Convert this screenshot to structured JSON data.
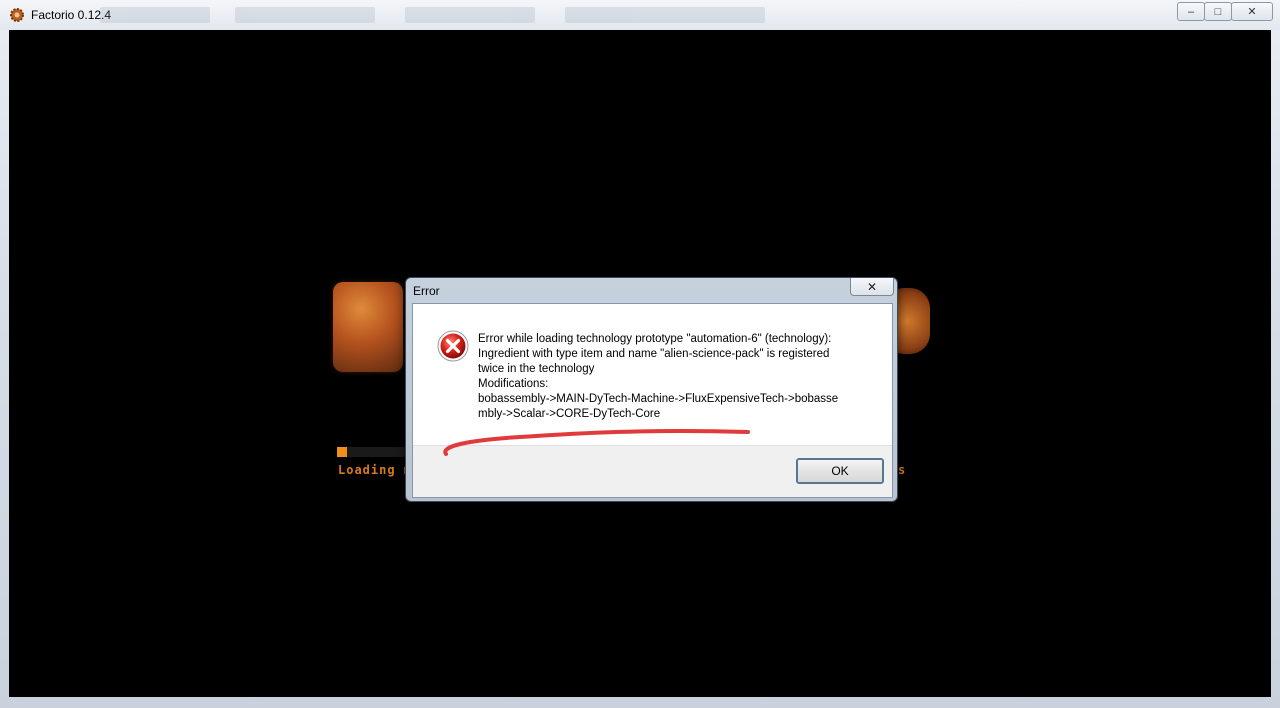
{
  "window": {
    "title": "Factorio 0.12.4",
    "minimize_glyph": "–",
    "maximize_glyph": "□",
    "close_glyph": "✕"
  },
  "loading": {
    "label": "Loading m",
    "right_label": "s",
    "progress_fraction": 0.07,
    "accent_color": "#f28f1a"
  },
  "dialog": {
    "title": "Error",
    "close_glyph": "✕",
    "icon": "error-icon",
    "message_lines": [
      "Error while loading technology prototype \"automation-6\" (technology):",
      "Ingredient with type item and name \"alien-science-pack\" is registered",
      "twice in the technology",
      "Modifications:",
      "bobassembly->MAIN-DyTech-Machine->FluxExpensiveTech->bobasse",
      "mbly->Scalar->CORE-DyTech-Core"
    ],
    "ok_label": "OK",
    "annotation_color": "#e03a3a"
  }
}
